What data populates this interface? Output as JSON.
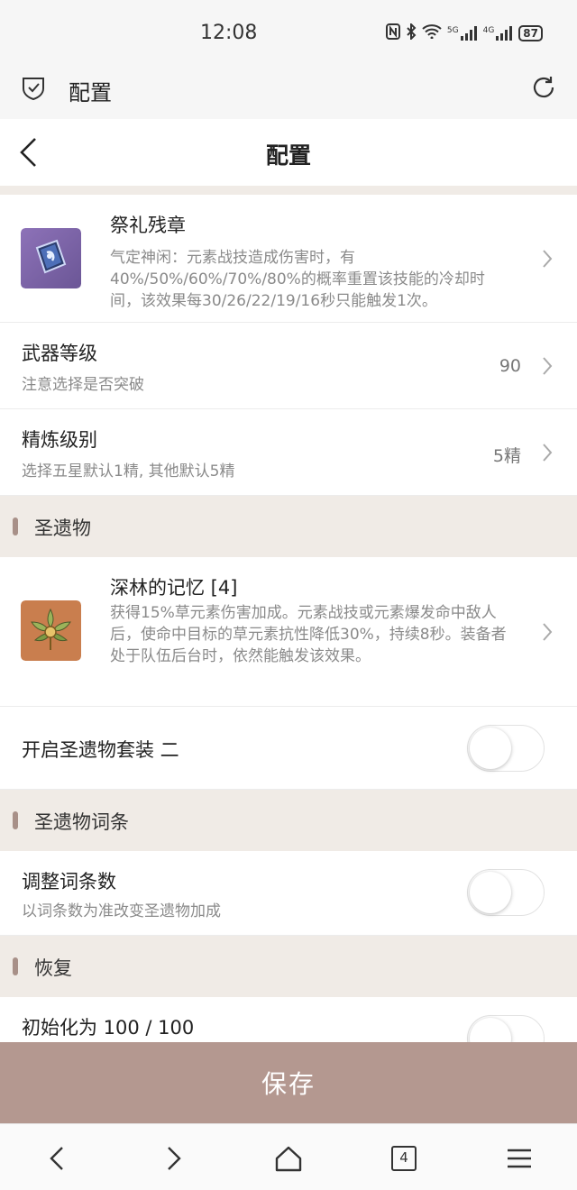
{
  "status": {
    "time": "12:08",
    "battery": "87",
    "signal1": "5G",
    "signal2": "4G"
  },
  "appbar": {
    "title": "配置"
  },
  "nav": {
    "title": "配置"
  },
  "weapon": {
    "name": "祭礼残章",
    "desc": "气定神闲：元素战技造成伤害时，有40%/50%/60%/70%/80%的概率重置该技能的冷却时间，该效果每30/26/22/19/16秒只能触发1次。"
  },
  "weapon_level": {
    "label": "武器等级",
    "sub": "注意选择是否突破",
    "value": "90"
  },
  "refine": {
    "label": "精炼级别",
    "sub": "选择五星默认1精, 其他默认5精",
    "value": "5精"
  },
  "section_artifacts": {
    "title": "圣遗物"
  },
  "artifact": {
    "name": "深林的记忆 [4]",
    "desc": "获得15%草元素伤害加成。元素战技或元素爆发命中敌人后，使命中目标的草元素抗性降低30%，持续8秒。装备者处于队伍后台时，依然能触发该效果。"
  },
  "set2": {
    "label": "开启圣遗物套装 二",
    "on": false
  },
  "section_substats": {
    "title": "圣遗物词条"
  },
  "substats": {
    "label": "调整词条数",
    "sub": "以词条数为准改变圣遗物加成",
    "on": false
  },
  "section_restore": {
    "title": "恢复"
  },
  "restore": {
    "label": "初始化为 100 / 100",
    "on": false
  },
  "save": {
    "label": "保存"
  },
  "bottom_nav": {
    "tabs_count": "4"
  }
}
